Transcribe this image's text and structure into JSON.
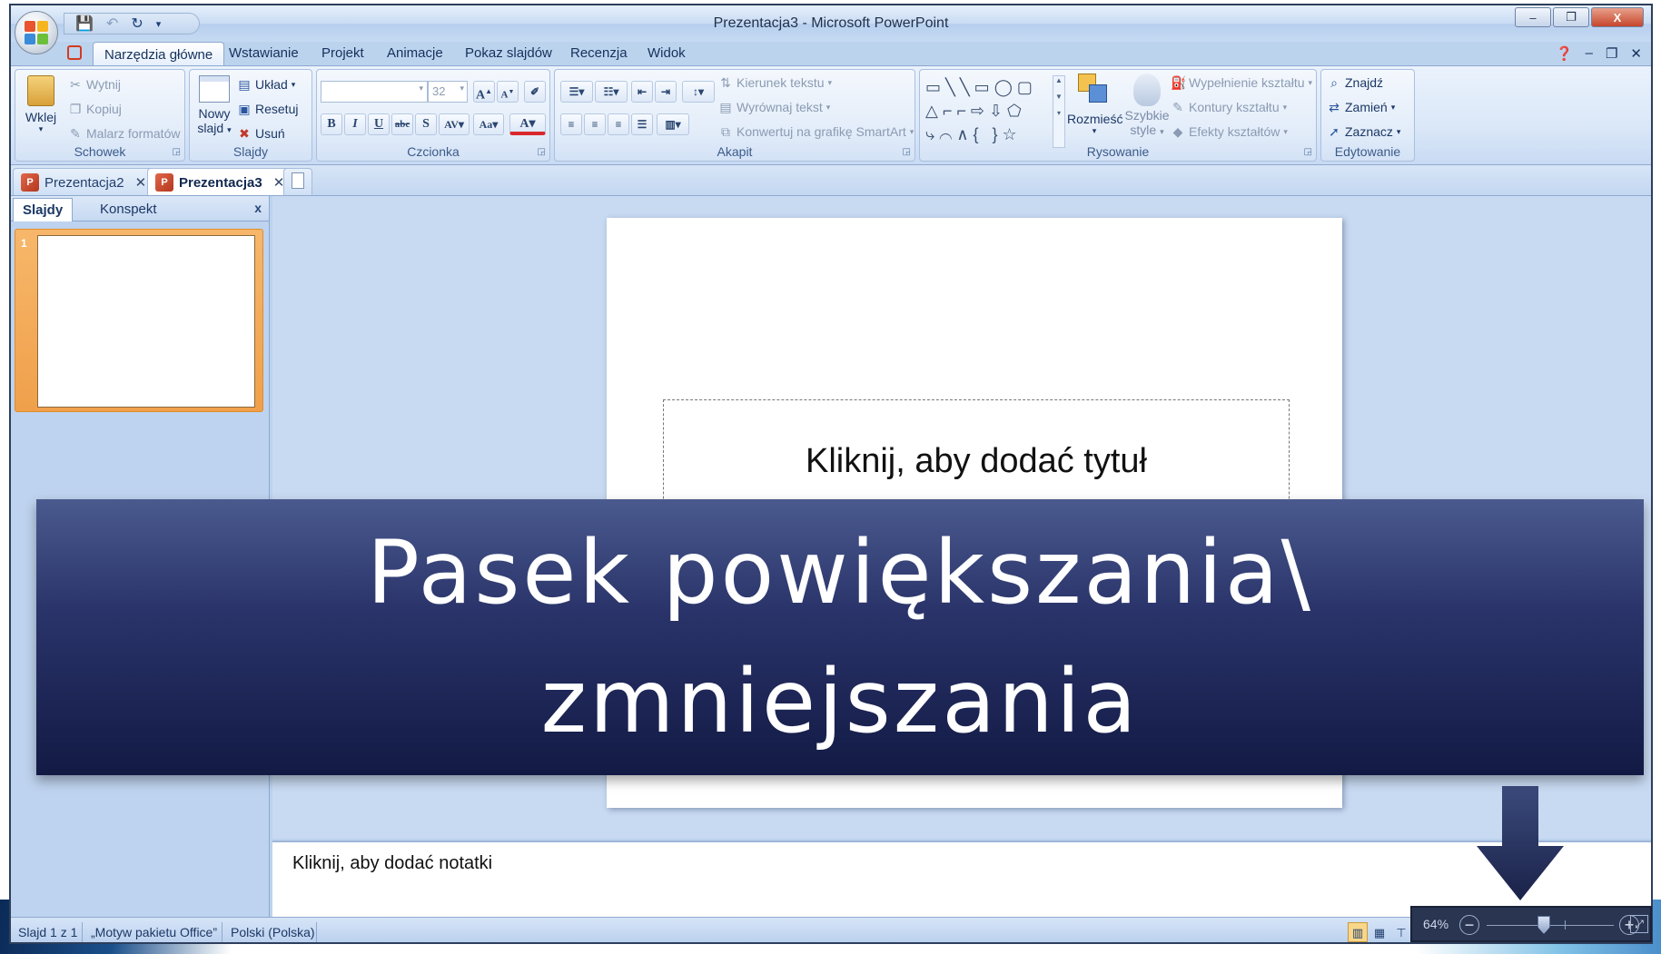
{
  "window": {
    "title": "Prezentacja3 - Microsoft PowerPoint",
    "controls": [
      "–",
      "❐",
      "X"
    ]
  },
  "ribbon_tabs": [
    "Narzędzia główne",
    "Wstawianie",
    "Projekt",
    "Animacje",
    "Pokaz slajdów",
    "Recenzja",
    "Widok"
  ],
  "ribbon": {
    "clipboard": {
      "label": "Schowek",
      "paste": "Wklej",
      "cut": "Wytnij",
      "copy": "Kopiuj",
      "format_painter": "Malarz formatów"
    },
    "slides": {
      "label": "Slajdy",
      "new_slide_1": "Nowy",
      "new_slide_2": "slajd",
      "layout": "Układ",
      "reset": "Resetuj",
      "delete": "Usuń"
    },
    "font": {
      "label": "Czcionka",
      "size": "32"
    },
    "paragraph": {
      "label": "Akapit",
      "text_direction": "Kierunek tekstu",
      "align_text": "Wyrównaj tekst",
      "convert_smartart": "Konwertuj na grafikę SmartArt"
    },
    "drawing": {
      "label": "Rysowanie",
      "arrange": "Rozmieść",
      "quick_styles_1": "Szybkie",
      "quick_styles_2": "style",
      "shape_fill": "Wypełnienie kształtu",
      "shape_outline": "Kontury kształtu",
      "shape_effects": "Efekty kształtów"
    },
    "editing": {
      "label": "Edytowanie",
      "find": "Znajdź",
      "replace": "Zamień",
      "select": "Zaznacz"
    }
  },
  "doc_tabs": [
    {
      "label": "Prezentacja2",
      "active": false
    },
    {
      "label": "Prezentacja3",
      "active": true
    }
  ],
  "left_pane": {
    "tabs": [
      "Slajdy",
      "Konspekt"
    ],
    "close": "x",
    "slide_number": "1"
  },
  "slide": {
    "title_placeholder": "Kliknij, aby dodać tytuł"
  },
  "notes": {
    "placeholder": "Kliknij, aby dodać notatki"
  },
  "status_bar": {
    "slide_info": "Slajd 1 z 1",
    "theme": "„Motyw pakietu Office”",
    "language": "Polski (Polska)",
    "zoom_percent": "64%",
    "zoom_level": 0.45
  },
  "overlay": {
    "line1": "Pasek powiększania\\",
    "line2": "zmniejszania"
  },
  "colors": {
    "banner_top": "#4a5a8e",
    "banner_bottom": "#121a44",
    "arrow": "#23305c",
    "ribbon": "#dbe8f8",
    "active_slide_highlight": "#f0a04b"
  }
}
